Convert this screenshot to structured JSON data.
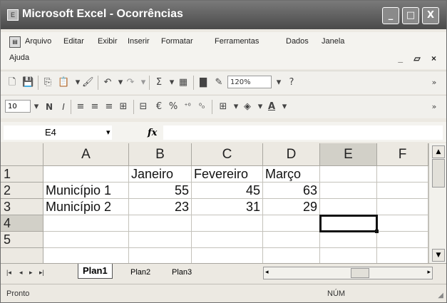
{
  "window": {
    "app_icon": "excel-app-icon",
    "title": "Microsoft Excel - Ocorrências",
    "minimize_glyph": "_",
    "maximize_glyph": "□",
    "close_glyph": "X"
  },
  "menu": {
    "items": [
      "Arquivo",
      "Editar",
      "Exibir",
      "Inserir",
      "Formatar",
      "Ferramentas",
      "Dados",
      "Janela",
      "Ajuda"
    ],
    "doc_controls": "_ ▱ ×"
  },
  "toolbar_standard": {
    "zoom": "120%",
    "help_glyph": "?",
    "sum_glyph": "Σ",
    "overflow_glyph": "»"
  },
  "toolbar_formatting": {
    "font_size": "10",
    "bold_glyph": "N",
    "italic_glyph": "I",
    "currency_glyph": "€",
    "percent_glyph": "%",
    "font_color_glyph": "A",
    "overflow_glyph": "»"
  },
  "formula_bar": {
    "name_box": "E4",
    "fx_label": "fx",
    "formula": ""
  },
  "sheet": {
    "columns": [
      "A",
      "B",
      "C",
      "D",
      "E",
      "F"
    ],
    "rows": [
      "1",
      "2",
      "3",
      "4",
      "5"
    ],
    "selected_column": "E",
    "selected_row": "4",
    "active_cell": "E4",
    "cells": [
      [
        "",
        "Janeiro",
        "Fevereiro",
        "Março",
        "",
        ""
      ],
      [
        "Município 1",
        "55",
        "45",
        "63",
        "",
        ""
      ],
      [
        "Município 2",
        "23",
        "31",
        "29",
        "",
        ""
      ],
      [
        "",
        "",
        "",
        "",
        "",
        ""
      ],
      [
        "",
        "",
        "",
        "",
        "",
        ""
      ]
    ]
  },
  "sheet_tabs": {
    "nav": [
      "|◂",
      "◂",
      "▸",
      "▸|"
    ],
    "tabs": [
      "Plan1",
      "Plan2",
      "Plan3"
    ],
    "active": "Plan1"
  },
  "status_bar": {
    "left": "Pronto",
    "num_lock": "NÚM"
  }
}
